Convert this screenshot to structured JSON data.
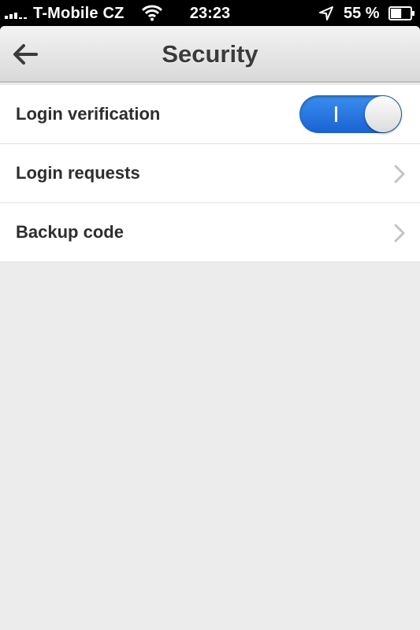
{
  "status_bar": {
    "carrier": "T-Mobile CZ",
    "time": "23:23",
    "battery_text": "55 %",
    "battery_level": 0.55,
    "icons": [
      "signal-icon",
      "wifi-icon",
      "location-icon",
      "battery-icon"
    ]
  },
  "nav": {
    "title": "Security",
    "back_icon": "back-arrow-icon"
  },
  "settings": {
    "items": [
      {
        "label": "Login verification",
        "control": "toggle",
        "toggle_on": true
      },
      {
        "label": "Login requests",
        "control": "chevron"
      },
      {
        "label": "Backup code",
        "control": "chevron"
      }
    ]
  },
  "colors": {
    "toggle_on": "#1a62d2",
    "background": "#ececec",
    "label": "#2e2e2e"
  }
}
